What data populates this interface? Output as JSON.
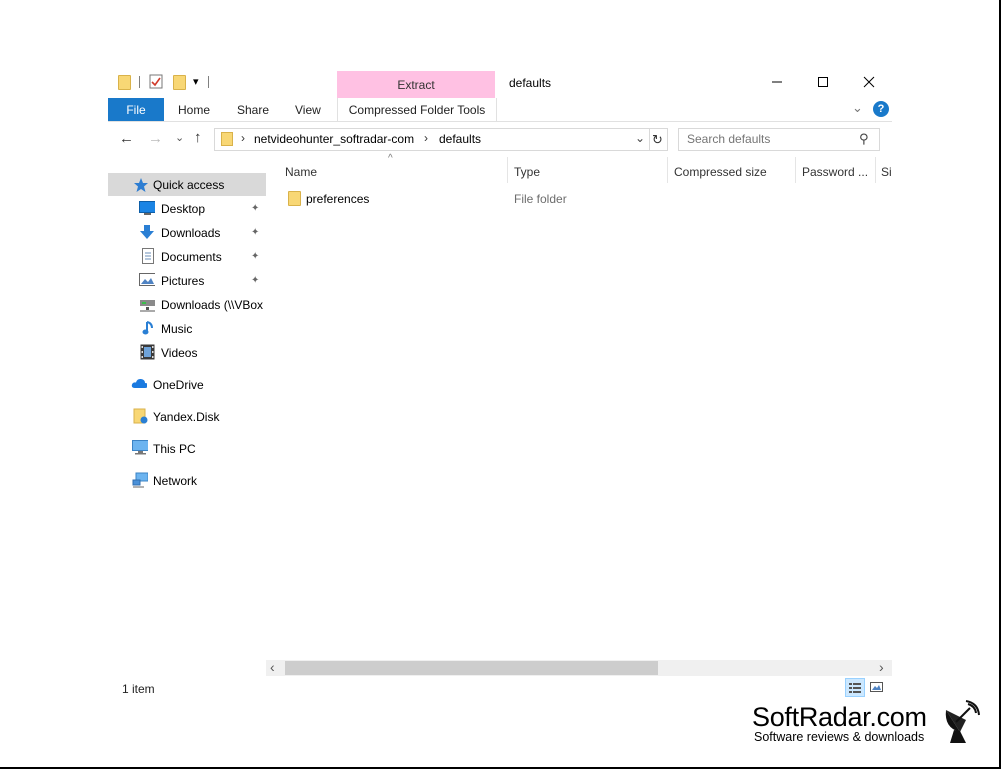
{
  "window": {
    "title": "defaults",
    "context_tab": "Extract",
    "minimize_glyph": "—",
    "maximize_glyph": "☐",
    "close_glyph": "✕"
  },
  "quick_access_toolbar": {
    "dropdown_glyph": "▾"
  },
  "ribbon": {
    "tabs": [
      "File",
      "Home",
      "Share",
      "View",
      "Compressed Folder Tools"
    ],
    "help_glyph": "?",
    "expand_glyph": "⌄"
  },
  "address": {
    "back_glyph": "←",
    "forward_glyph": "→",
    "recent_glyph": "⌄",
    "up_glyph": "↑",
    "separator_glyph": "›",
    "path": [
      "netvideohunter_softradar-com",
      "defaults"
    ],
    "dropdown_glyph": "⌄",
    "refresh_glyph": "↻",
    "search_placeholder": "Search defaults",
    "search_glyph": "⚲"
  },
  "nav_pane": {
    "pin_glyph": "📌",
    "items": [
      {
        "label": "Quick access",
        "icon": "star-icon",
        "selected": true
      },
      {
        "label": "Desktop",
        "icon": "desktop-icon",
        "pinned": true
      },
      {
        "label": "Downloads",
        "icon": "download-icon",
        "pinned": true
      },
      {
        "label": "Documents",
        "icon": "documents-icon",
        "pinned": true
      },
      {
        "label": "Pictures",
        "icon": "pictures-icon",
        "pinned": true
      },
      {
        "label": "Downloads (\\\\VBox",
        "icon": "network-drive-icon"
      },
      {
        "label": "Music",
        "icon": "music-icon"
      },
      {
        "label": "Videos",
        "icon": "videos-icon"
      },
      {
        "label": "OneDrive",
        "icon": "cloud-icon"
      },
      {
        "label": "Yandex.Disk",
        "icon": "yandex-disk-icon"
      },
      {
        "label": "This PC",
        "icon": "computer-icon"
      },
      {
        "label": "Network",
        "icon": "network-icon"
      }
    ]
  },
  "file_list": {
    "sort_glyph": "^",
    "columns": [
      "Name",
      "Type",
      "Compressed size",
      "Password ...",
      "Si"
    ],
    "rows": [
      {
        "name": "preferences",
        "type": "File folder",
        "icon": "folder-icon"
      }
    ]
  },
  "scrollbar": {
    "left_glyph": "‹",
    "right_glyph": "›"
  },
  "status_bar": {
    "item_count": "1 item"
  },
  "watermark": {
    "brand": "SoftRadar.com",
    "tagline": "Software reviews & downloads"
  },
  "colors": {
    "accent": "#1979ca",
    "context_tab": "#ffc1e3",
    "selection": "#d9d9d9",
    "folder": "#f8d775"
  }
}
